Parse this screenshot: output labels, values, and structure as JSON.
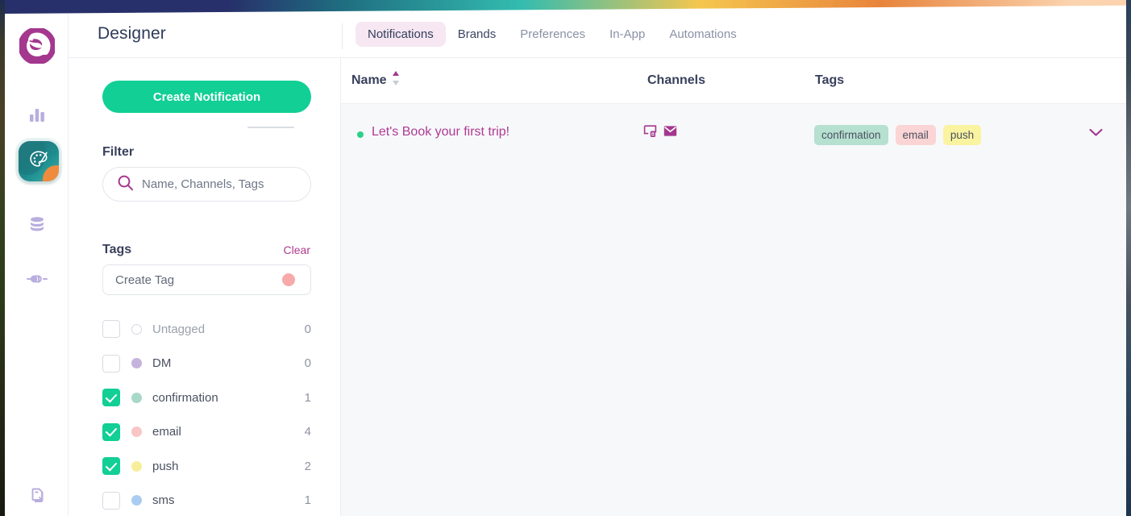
{
  "app": {
    "title": "Designer",
    "logo_icon": "courier-logo-icon"
  },
  "rail": {
    "items": [
      {
        "name": "analytics",
        "icon": "bar-chart-icon"
      },
      {
        "name": "designer",
        "icon": "palette-icon",
        "active": true
      },
      {
        "name": "data",
        "icon": "database-icon"
      },
      {
        "name": "integrations",
        "icon": "plug-icon"
      },
      {
        "name": "logs",
        "icon": "documents-icon"
      }
    ]
  },
  "tabs": [
    {
      "label": "Notifications",
      "active": true
    },
    {
      "label": "Brands",
      "active": false,
      "strong": true
    },
    {
      "label": "Preferences",
      "active": false
    },
    {
      "label": "In-App",
      "active": false
    },
    {
      "label": "Automations",
      "active": false
    }
  ],
  "panel": {
    "create_button": "Create Notification",
    "filter_heading": "Filter",
    "search": {
      "value": "",
      "placeholder": "Name, Channels, Tags",
      "icon": "search-icon"
    },
    "tags_heading": "Tags",
    "clear_label": "Clear",
    "create_tag": {
      "value": "",
      "placeholder": "Create Tag",
      "dot_color": "#f8a9a9"
    },
    "tag_items": [
      {
        "label": "Untagged",
        "count": "0",
        "checked": false,
        "dot_color": "",
        "muted": true
      },
      {
        "label": "DM",
        "count": "0",
        "checked": false,
        "dot_color": "#c5b3de",
        "muted": false
      },
      {
        "label": "confirmation",
        "count": "1",
        "checked": true,
        "dot_color": "#a8d8c8",
        "muted": false
      },
      {
        "label": "email",
        "count": "4",
        "checked": true,
        "dot_color": "#f9c5c5",
        "muted": false
      },
      {
        "label": "push",
        "count": "2",
        "checked": true,
        "dot_color": "#f7ee9a",
        "muted": false
      },
      {
        "label": "sms",
        "count": "1",
        "checked": false,
        "dot_color": "#a9cdf0",
        "muted": false
      }
    ]
  },
  "table": {
    "columns": {
      "name": "Name",
      "channels": "Channels",
      "tags": "Tags"
    },
    "sort": {
      "column": "Name",
      "direction": "asc"
    },
    "rows": [
      {
        "status": "active",
        "name": "Let's Book your first trip!",
        "channels": [
          {
            "name": "in-app",
            "icon": "device-icon"
          },
          {
            "name": "email",
            "icon": "envelope-icon"
          }
        ],
        "tags": [
          {
            "label": "confirmation",
            "bg": "#b6e0d0"
          },
          {
            "label": "email",
            "bg": "#fbd5d5"
          },
          {
            "label": "push",
            "bg": "#faf3a0"
          }
        ],
        "expand_icon": "chevron-down-icon"
      }
    ]
  },
  "colors": {
    "accent_green": "#11cf95",
    "accent_purple": "#ad3b93",
    "tab_active_bg": "#f6e7f2",
    "content_bg": "#f7f8fa"
  }
}
